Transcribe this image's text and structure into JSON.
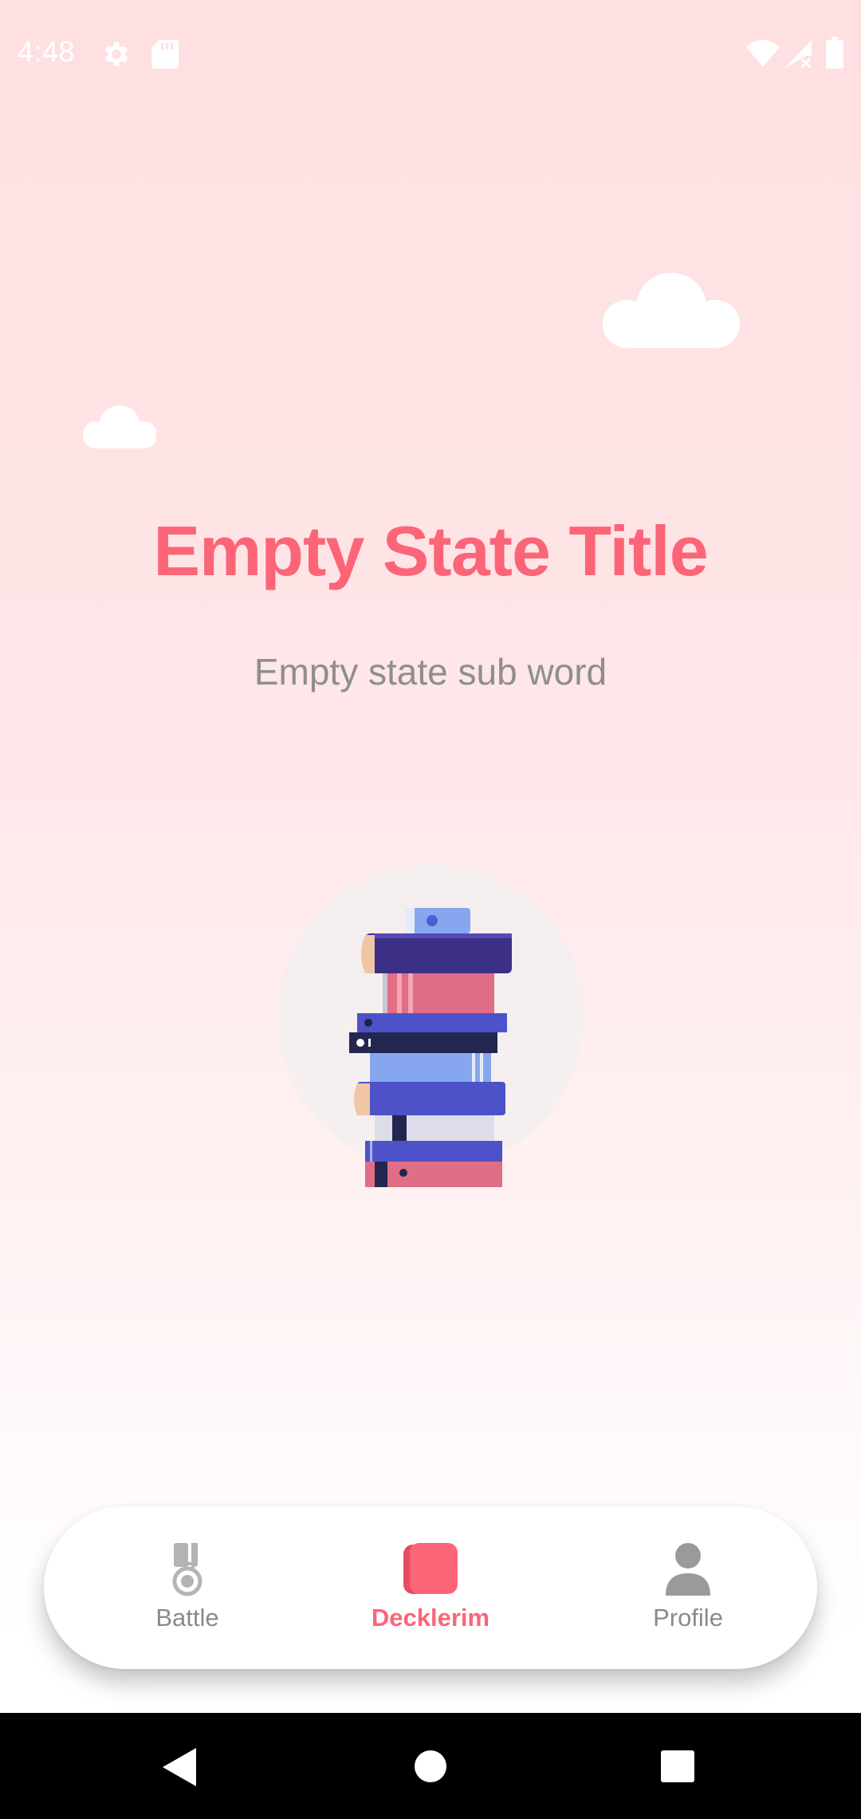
{
  "status_bar": {
    "time": "4:48",
    "left_icons": [
      "settings-icon",
      "sd-card-icon"
    ],
    "right_icons": [
      "wifi-icon",
      "cell-signal-icon",
      "battery-icon"
    ]
  },
  "empty_state": {
    "title": "Empty State Title",
    "subtitle": "Empty state sub word",
    "illustration": "book-stack-illustration"
  },
  "bottom_nav": {
    "items": [
      {
        "label": "Battle",
        "icon": "medal-icon",
        "active": false
      },
      {
        "label": "Decklerim",
        "icon": "cards-icon",
        "active": true
      },
      {
        "label": "Profile",
        "icon": "person-icon",
        "active": false
      }
    ]
  },
  "system_nav": {
    "buttons": [
      "back-icon",
      "home-icon",
      "recents-icon"
    ]
  },
  "colors": {
    "accent": "#fc6578",
    "title": "#fc6578",
    "subtitle": "#8e8e8e",
    "nav_inactive": "#8a8a8a",
    "background_top": "#ffe0e1",
    "background_bottom": "#ffffff"
  }
}
